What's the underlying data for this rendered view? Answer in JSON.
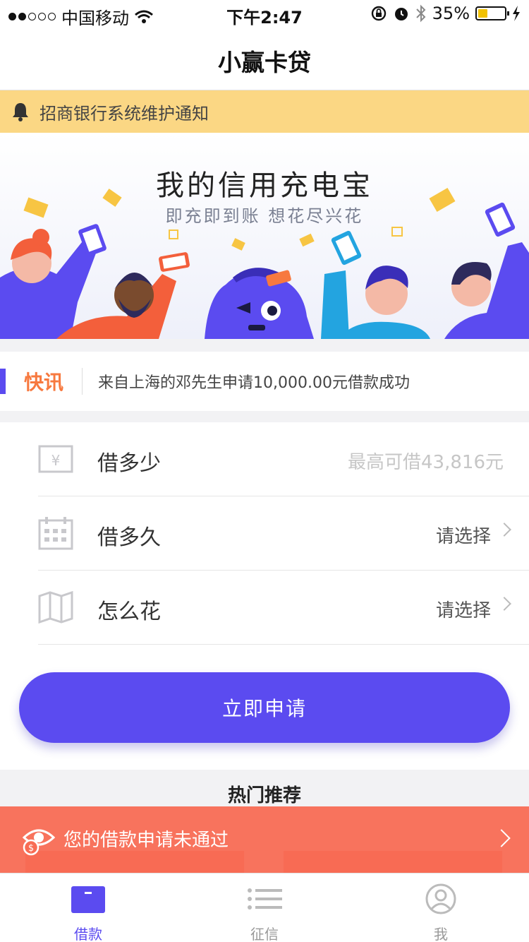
{
  "status_bar": {
    "carrier": "中国移动",
    "time": "下午2:47",
    "battery": "35%"
  },
  "nav": {
    "title": "小赢卡贷"
  },
  "notice": {
    "text": "招商银行系统维护通知",
    "icon": "bell-icon"
  },
  "banner": {
    "headline": "我的信用充电宝",
    "subtitle": "即充即到账 想花尽兴花"
  },
  "flash": {
    "tag": "快讯",
    "message": "来自上海的邓先生申请10,000.00元借款成功"
  },
  "form": {
    "rows": [
      {
        "label": "借多少",
        "value": "最高可借43,816元",
        "icon": "yen-icon"
      },
      {
        "label": "借多久",
        "value": "请选择",
        "icon": "calendar-icon"
      },
      {
        "label": "怎么花",
        "value": "请选择",
        "icon": "map-icon"
      }
    ]
  },
  "apply_button": {
    "label": "立即申请"
  },
  "hot": {
    "title": "热门推荐"
  },
  "reject_banner": {
    "text": "您的借款申请未通过",
    "icon": "eye-coin-icon"
  },
  "tabs": [
    {
      "label": "借款",
      "icon": "wallet-icon",
      "active": true
    },
    {
      "label": "征信",
      "icon": "list-icon",
      "active": false
    },
    {
      "label": "我",
      "icon": "user-icon",
      "active": false
    }
  ],
  "colors": {
    "primary": "#5b4bf0",
    "notice_bg": "#fbd784",
    "flash_tag": "#f7793f",
    "reject_bg": "#f86c54"
  }
}
